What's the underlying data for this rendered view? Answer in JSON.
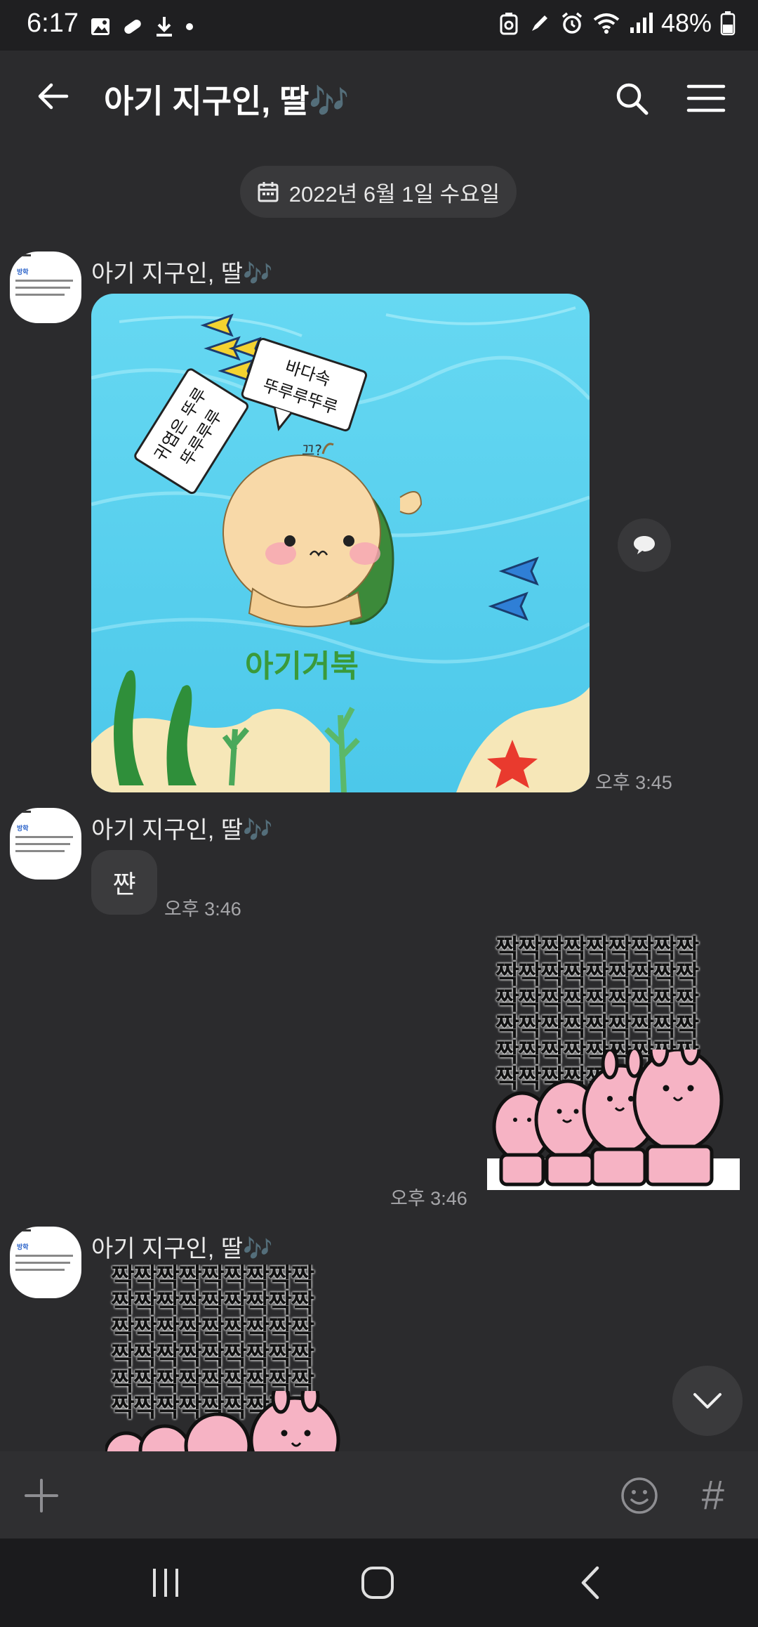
{
  "status_bar": {
    "time": "6:17",
    "battery": "48%",
    "notification_icons": [
      "gallery-icon",
      "pill-icon",
      "download-icon",
      "dot-icon"
    ],
    "system_icons": [
      "recycle-icon",
      "pen-icon",
      "alarm-icon",
      "wifi-icon",
      "signal-icon",
      "battery-icon"
    ]
  },
  "header": {
    "title": "아기 지구인, 딸",
    "title_emoji": "🎶",
    "accent": "#a04ad8"
  },
  "date_chip": {
    "label": "2022년 6월 1일 수요일"
  },
  "messages": [
    {
      "sender": "아기 지구인, 딸",
      "type": "image",
      "image": {
        "bubble_1": "바다속\n뚜루루뚜루",
        "bubble_2": "귀엽은 뚜루\n뚜루루루",
        "small_text": "끄?",
        "caption": "아기거북"
      },
      "time": "오후 3:45"
    },
    {
      "sender": "아기 지구인, 딸",
      "type": "text",
      "text": "쨘",
      "time": "오후 3:46"
    },
    {
      "type": "sticker_outgoing",
      "sticker_text": "짝",
      "time": "오후 3:46"
    },
    {
      "sender": "아기 지구인, 딸",
      "type": "sticker",
      "sticker_text": "짝"
    }
  ],
  "input_bar": {
    "add_icon": "plus-icon",
    "emoji_icon": "smile-icon",
    "hash_label": "#"
  },
  "colors": {
    "background": "#2b2b2d",
    "bubble": "#3b3b3d",
    "water": "#5fd3ef",
    "sticker_pink": "#f6b3c4"
  }
}
